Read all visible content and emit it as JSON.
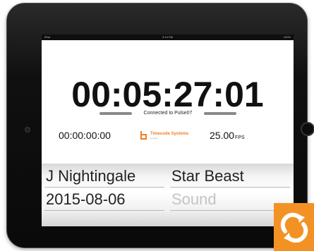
{
  "status_bar": {
    "left": "iPad",
    "time": "3:14 PM",
    "right": "100%"
  },
  "timecode": {
    "main": "00:05:27:01",
    "secondary": "00:00:00:00"
  },
  "connection": {
    "text": "Connected to Pulse07"
  },
  "logo": {
    "name": "Timecode Systems",
    "sub": "syncing"
  },
  "fps": {
    "value": "25.00",
    "unit": "FPS"
  },
  "picker": {
    "left_col": [
      "J Nightingale",
      "2015-08-06"
    ],
    "right_col": [
      "Star Beast",
      "Sound"
    ]
  },
  "colors": {
    "accent": "#f39224",
    "brand_orange": "#f07e26"
  },
  "icons": {
    "app_badge": "sync-arrows-icon"
  }
}
